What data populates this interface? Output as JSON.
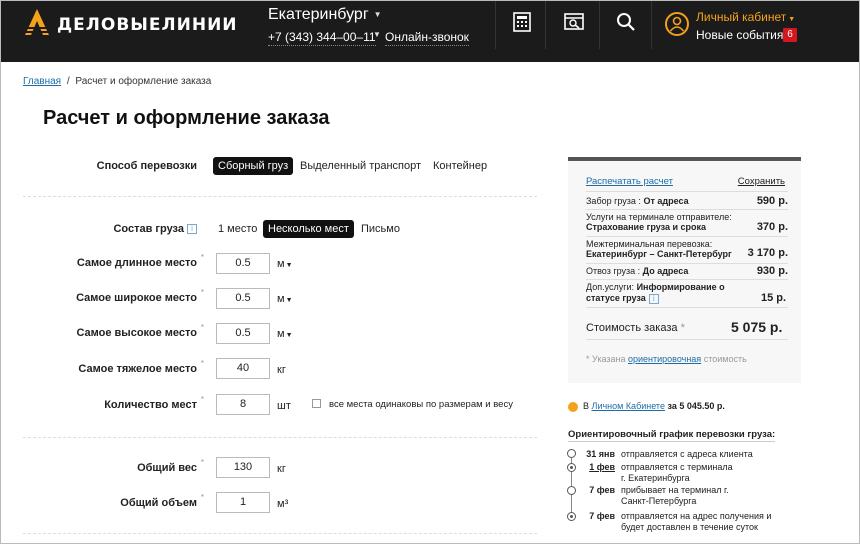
{
  "header": {
    "logo_text": "ДЕЛОВЫЕЛИНИИ",
    "city": "Екатеринбург",
    "phone": "+7 (343) 344–00–11",
    "online_call": "Онлайн-звонок",
    "account": "Личный кабинет",
    "events": "Новые события",
    "events_count": "6",
    "icons": [
      "calculator-icon",
      "tracking-icon",
      "search-icon",
      "user-icon"
    ],
    "accent": "#f4a11b"
  },
  "breadcrumb": {
    "home": "Главная",
    "sep": "/",
    "current": "Расчет и оформление заказа"
  },
  "page_title": "Расчет и оформление заказа",
  "transport": {
    "label": "Способ перевозки",
    "options": [
      "Сборный груз",
      "Выделенный транспорт",
      "Контейнер"
    ],
    "selected": "Сборный груз"
  },
  "cargo": {
    "label": "Состав груза",
    "info": "i",
    "options": [
      "1 место",
      "Несколько мест",
      "Письмо"
    ],
    "selected": "Несколько мест"
  },
  "fields": {
    "longest": {
      "label": "Самое длинное место",
      "value": "0.5",
      "unit": "м"
    },
    "widest": {
      "label": "Самое широкое место",
      "value": "0.5",
      "unit": "м"
    },
    "highest": {
      "label": "Самое высокое место",
      "value": "0.5",
      "unit": "м"
    },
    "heaviest": {
      "label": "Самое тяжелое место",
      "value": "40",
      "unit": "кг"
    },
    "count": {
      "label": "Количество мест",
      "value": "8",
      "unit": "шт",
      "same_label": "все места одинаковы по размерам и весу"
    },
    "total_weight": {
      "label": "Общий вес",
      "value": "130",
      "unit": "кг"
    },
    "total_volume": {
      "label": "Общий объем",
      "value": "1",
      "unit": "м³"
    }
  },
  "required_mark": "*",
  "summary": {
    "print": "Распечатать расчет",
    "save": "Сохранить",
    "rows": [
      {
        "label": "Забор груза :",
        "bold": "От адреса",
        "price": "590 р."
      },
      {
        "label": "Услуги на терминале отправителе:",
        "bold": "Страхование груза и срока",
        "price": "370 р."
      },
      {
        "label": "Межтерминальная перевозка:",
        "bold": "Екатеринбург – Санкт-Петербург",
        "price": "3 170 р."
      },
      {
        "label": "Отвоз груза :",
        "bold": "До адреса",
        "price": "930 р."
      },
      {
        "label": "Доп.услуги:",
        "bold": "Информирование о статусе груза",
        "price": "15 р."
      }
    ],
    "total_label": "Стоимость заказа",
    "total_star": "*",
    "total": "5 075 р.",
    "note_prefix": "* Указана",
    "note_link": "ориентировочная",
    "note_suffix": "стоимость"
  },
  "bonus": {
    "prefix": "В",
    "link": "Личном Кабинете",
    "suffix": "за 5 045.50 р."
  },
  "schedule": {
    "title": "Ориентировочный график перевозки груза:",
    "items": [
      {
        "date": "31 янв",
        "text": "отправляется с адреса клиента"
      },
      {
        "date": "1 фев",
        "text": "отправляется с терминала г. Екатеринбурга"
      },
      {
        "date": "7 фев",
        "text": "прибывает на терминал г. Санкт-Петербурга"
      },
      {
        "date": "7 фев",
        "text": "отправляется на адрес получения и будет доставлен в течение суток"
      }
    ]
  }
}
